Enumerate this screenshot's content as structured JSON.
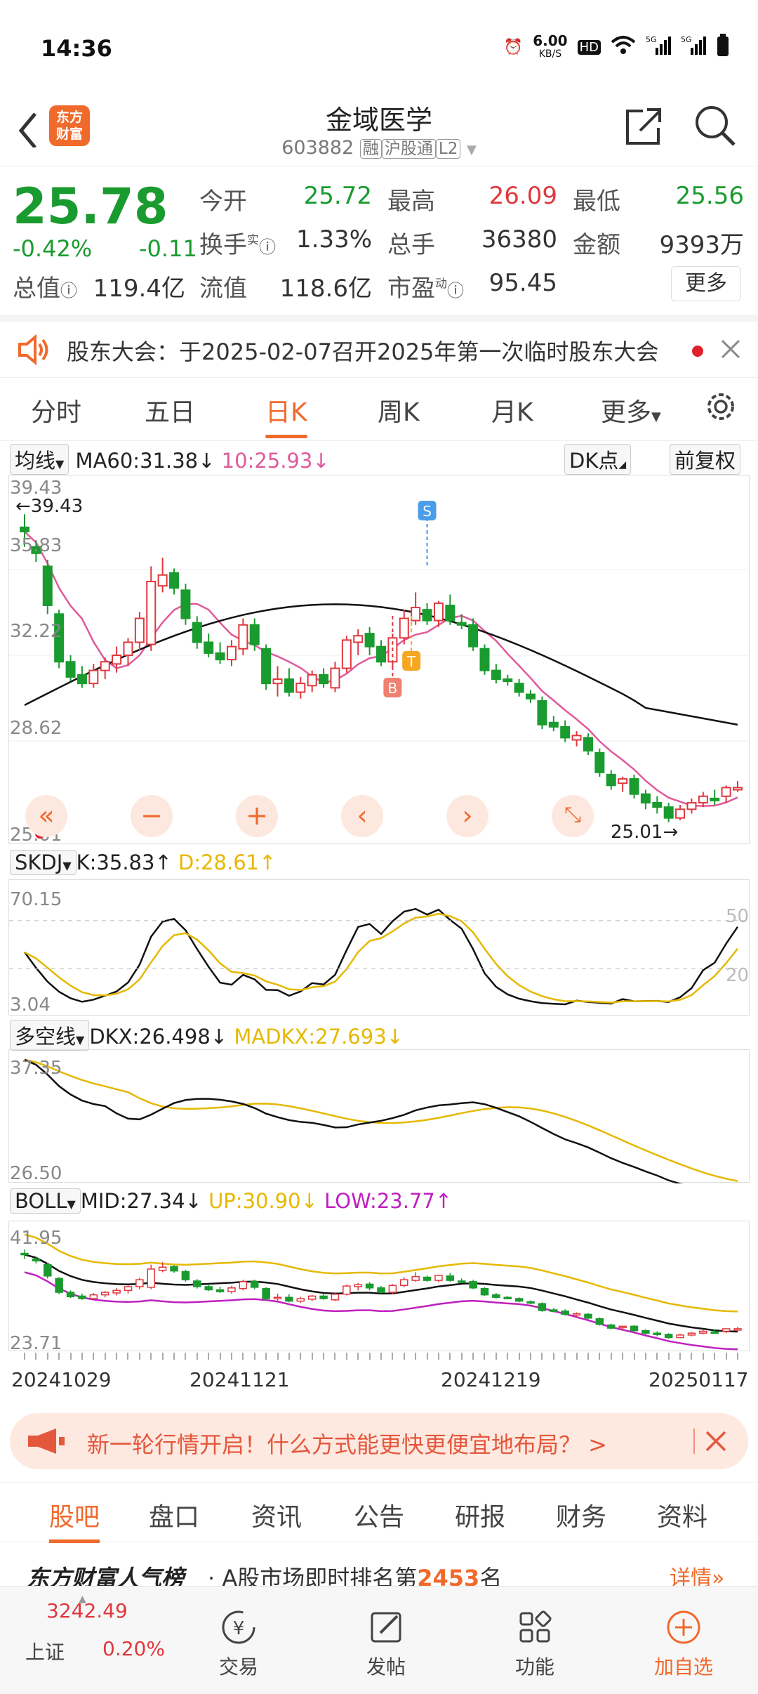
{
  "status": {
    "time": "14:36",
    "speed": "6.00",
    "speed_unit": "KB/S",
    "hd": "HD",
    "sig1": "5G",
    "sig2": "5G"
  },
  "header": {
    "logo": "东方\n财富",
    "title": "金域医学",
    "code": "603882",
    "tag1": "融",
    "tag2": "沪股通",
    "tag3": "L2"
  },
  "quote": {
    "price": "25.78",
    "pct": "-0.42%",
    "chg": "-0.11",
    "open_l": "今开",
    "open": "25.72",
    "high_l": "最高",
    "high": "26.09",
    "low_l": "最低",
    "low": "25.56",
    "turn_l": "换手",
    "turn_sup": "实",
    "turn": "1.33%",
    "vol_l": "总手",
    "vol": "36380",
    "amt_l": "金额",
    "amt": "9393万",
    "mcap_l": "总值",
    "mcap": "119.4亿",
    "float_l": "流值",
    "float": "118.6亿",
    "pe_l": "市盈",
    "pe_sup": "动",
    "pe": "95.45",
    "more": "更多"
  },
  "notice": {
    "text": "股东大会：于2025-02-07召开2025年第一次临时股东大会"
  },
  "tabs": [
    "分时",
    "五日",
    "日K",
    "周K",
    "月K",
    "更多"
  ],
  "ma": {
    "sel": "均线",
    "ma60": "MA60:31.38",
    "ma10": "10:25.93",
    "dk": "DK点",
    "fq": "前复权"
  },
  "kaxis": {
    "top": "39.43",
    "marker": "39.43",
    "l2": "35.83",
    "l3": "32.22",
    "l4": "28.62",
    "bottom": "25.01",
    "low_mark": "25.01"
  },
  "signals": {
    "s": "S",
    "t": "T",
    "b": "B"
  },
  "skdj": {
    "sel": "SKDJ",
    "k": "K:35.83",
    "d": "D:28.61",
    "top": "70.15",
    "bottom": "3.04",
    "r50": "50",
    "r20": "20"
  },
  "dkx": {
    "sel": "多空线",
    "dkx": "DKX:26.498",
    "mad": "MADKX:27.693",
    "top": "37.35",
    "bottom": "26.50"
  },
  "boll": {
    "sel": "BOLL",
    "mid": "MID:27.34",
    "up": "UP:30.90",
    "low": "LOW:23.77",
    "top": "41.95",
    "bottom": "23.71"
  },
  "dates": [
    "20241029",
    "20241121",
    "20241219",
    "20250117"
  ],
  "promo": {
    "text": "新一轮行情开启！什么方式能更快更便宜地布局？ >"
  },
  "btabs": [
    "股吧",
    "盘口",
    "资讯",
    "公告",
    "研报",
    "财务",
    "资料"
  ],
  "rank": {
    "brand": "东方财富人气榜",
    "mid": "· A股市场即时排名第",
    "num": "2453",
    "suffix": "名",
    "detail": "详情"
  },
  "nav": {
    "index_val": "3242.49",
    "index_name": "上证",
    "index_pct": "0.20%",
    "trade": "交易",
    "post": "发帖",
    "func": "功能",
    "add": "加自选"
  },
  "colors": {
    "up": "#e0383e",
    "down": "#1a9b2f",
    "accent": "#f06a2c",
    "ma10": "#e05a9b",
    "ma60": "#111111"
  },
  "chart_data": {
    "type": "candlestick",
    "candles": [
      [
        37.8,
        38.4,
        36.9,
        37.6
      ],
      [
        36.9,
        37.2,
        36.2,
        36.6
      ],
      [
        36.0,
        36.3,
        33.8,
        34.2
      ],
      [
        33.8,
        34.0,
        31.3,
        31.6
      ],
      [
        31.6,
        31.9,
        30.7,
        30.9
      ],
      [
        31.0,
        31.4,
        30.4,
        30.6
      ],
      [
        30.6,
        31.5,
        30.4,
        31.2
      ],
      [
        31.2,
        31.8,
        30.8,
        31.6
      ],
      [
        31.5,
        32.3,
        31.1,
        31.9
      ],
      [
        31.9,
        32.7,
        31.4,
        32.5
      ],
      [
        32.5,
        33.9,
        32.1,
        33.6
      ],
      [
        32.4,
        36.0,
        32.1,
        35.3
      ],
      [
        35.1,
        36.4,
        34.8,
        35.6
      ],
      [
        35.7,
        35.9,
        34.7,
        35.0
      ],
      [
        34.9,
        35.2,
        33.3,
        33.6
      ],
      [
        33.4,
        33.7,
        32.2,
        32.5
      ],
      [
        32.5,
        32.9,
        31.8,
        32.0
      ],
      [
        32.0,
        32.5,
        31.5,
        31.7
      ],
      [
        31.7,
        32.6,
        31.4,
        32.3
      ],
      [
        32.2,
        33.6,
        31.9,
        33.3
      ],
      [
        33.3,
        33.6,
        32.1,
        32.4
      ],
      [
        32.2,
        32.4,
        30.3,
        30.6
      ],
      [
        30.6,
        31.4,
        30.0,
        30.8
      ],
      [
        30.8,
        31.3,
        30.0,
        30.2
      ],
      [
        30.2,
        30.9,
        29.9,
        30.6
      ],
      [
        30.5,
        31.2,
        30.2,
        31.0
      ],
      [
        31.0,
        31.3,
        30.4,
        30.6
      ],
      [
        30.4,
        31.6,
        30.2,
        31.3
      ],
      [
        31.3,
        32.8,
        31.1,
        32.6
      ],
      [
        32.5,
        33.1,
        31.9,
        32.8
      ],
      [
        32.9,
        33.2,
        31.9,
        32.3
      ],
      [
        32.3,
        32.6,
        31.4,
        31.6
      ],
      [
        31.6,
        32.9,
        31.3,
        32.7
      ],
      [
        32.7,
        34.0,
        32.4,
        33.6
      ],
      [
        33.5,
        34.8,
        33.3,
        34.1
      ],
      [
        34.0,
        34.3,
        33.3,
        33.5
      ],
      [
        33.5,
        34.4,
        33.2,
        34.3
      ],
      [
        34.2,
        34.7,
        33.3,
        33.5
      ],
      [
        33.4,
        33.8,
        33.1,
        33.3
      ],
      [
        33.3,
        33.6,
        32.1,
        32.3
      ],
      [
        32.2,
        32.4,
        31.0,
        31.2
      ],
      [
        31.2,
        31.5,
        30.6,
        30.8
      ],
      [
        30.8,
        31.0,
        30.5,
        30.7
      ],
      [
        30.6,
        30.8,
        30.0,
        30.2
      ],
      [
        30.1,
        30.3,
        29.7,
        29.9
      ],
      [
        29.8,
        30.0,
        28.5,
        28.7
      ],
      [
        28.8,
        29.1,
        28.4,
        28.6
      ],
      [
        28.6,
        28.9,
        27.9,
        28.1
      ],
      [
        28.0,
        28.4,
        27.7,
        28.2
      ],
      [
        28.1,
        28.3,
        27.3,
        27.5
      ],
      [
        27.4,
        27.6,
        26.3,
        26.5
      ],
      [
        26.4,
        26.6,
        25.7,
        25.9
      ],
      [
        26.0,
        26.3,
        25.6,
        26.2
      ],
      [
        26.2,
        26.4,
        25.3,
        25.5
      ],
      [
        25.5,
        25.7,
        24.8,
        25.1
      ],
      [
        25.1,
        25.4,
        24.6,
        24.9
      ],
      [
        24.9,
        25.1,
        24.2,
        24.4
      ],
      [
        24.4,
        25.0,
        24.3,
        24.8
      ],
      [
        24.8,
        25.3,
        24.6,
        25.1
      ],
      [
        25.1,
        25.6,
        24.9,
        25.4
      ],
      [
        25.3,
        25.7,
        25.0,
        25.2
      ],
      [
        25.4,
        25.9,
        25.1,
        25.8
      ],
      [
        25.7,
        26.1,
        25.6,
        25.8
      ]
    ]
  }
}
